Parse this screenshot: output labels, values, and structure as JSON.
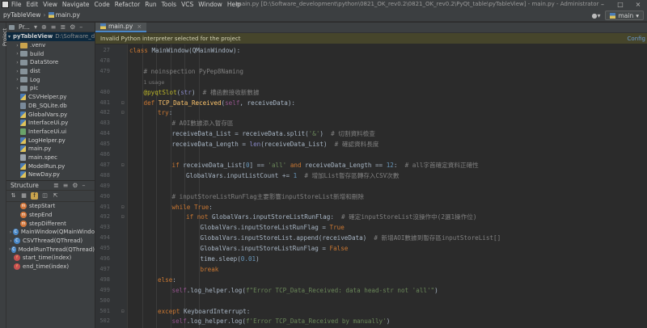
{
  "menubar": {
    "items": [
      "File",
      "Edit",
      "View",
      "Navigate",
      "Code",
      "Refactor",
      "Run",
      "Tools",
      "VCS",
      "Window",
      "Help"
    ],
    "window_title": "main.py [D:\\Software_development\\python\\0821_OK_rev0.2\\0821_OK_rev0.2\\PyQt_table\\pyTableView] - main.py - Administrator"
  },
  "navbar": {
    "project": "pyTableView",
    "file": "main.py",
    "run_config": "main"
  },
  "project_panel": {
    "title": "Pr...",
    "items": [
      {
        "label": "pyTableView",
        "path": "D:\\Software_de",
        "type": "root"
      },
      {
        "label": ".venv",
        "type": "folder-yellow"
      },
      {
        "label": "build",
        "type": "folder"
      },
      {
        "label": "DataStore",
        "type": "folder"
      },
      {
        "label": "dist",
        "type": "folder"
      },
      {
        "label": "Log",
        "type": "folder"
      },
      {
        "label": "pic",
        "type": "folder"
      },
      {
        "label": "CSVHelper.py",
        "type": "py"
      },
      {
        "label": "DB_SQLite.db",
        "type": "db"
      },
      {
        "label": "GlobalVars.py",
        "type": "py"
      },
      {
        "label": "InterfaceUi.py",
        "type": "py"
      },
      {
        "label": "InterfaceUi.ui",
        "type": "ui"
      },
      {
        "label": "LogHelper.py",
        "type": "py"
      },
      {
        "label": "main.py",
        "type": "py"
      },
      {
        "label": "main.spec",
        "type": "spec"
      },
      {
        "label": "ModelRun.py",
        "type": "py"
      },
      {
        "label": "NewDay.py",
        "type": "py"
      }
    ]
  },
  "structure_panel": {
    "title": "Structure",
    "items": [
      {
        "label": "stepStart",
        "kind": "method"
      },
      {
        "label": "stepEnd",
        "kind": "method"
      },
      {
        "label": "stepDifferent",
        "kind": "method"
      },
      {
        "label": "MainWindow(QMainWindo",
        "kind": "cls"
      },
      {
        "label": "CSVThread(QThread)",
        "kind": "cls"
      },
      {
        "label": "ModelRunThread(QThread)",
        "kind": "cls"
      },
      {
        "label": "start_time(index)",
        "kind": "fn"
      },
      {
        "label": "end_time(index)",
        "kind": "fn"
      }
    ]
  },
  "editor": {
    "tab_label": "main.py",
    "banner_text": "Invalid Python interpreter selected for the project",
    "banner_link": "Config",
    "lines": [
      {
        "ln": "27",
        "indent": 0,
        "parts": [
          [
            "kw",
            "class "
          ],
          [
            "txt",
            "MainWindow(QMainWindow):"
          ]
        ]
      },
      {
        "ln": "478",
        "indent": 0,
        "parts": []
      },
      {
        "ln": "479",
        "indent": 1,
        "parts": [
          [
            "cmt",
            "# noinspection PyPep8Naming"
          ]
        ]
      },
      {
        "ln": "",
        "indent": 1,
        "parts": [
          [
            "ann",
            "1 usage"
          ]
        ]
      },
      {
        "ln": "480",
        "indent": 1,
        "parts": [
          [
            "deco",
            "@pyqtSlot"
          ],
          [
            "txt",
            "("
          ],
          [
            "builtin",
            "str"
          ],
          [
            "txt",
            ")  "
          ],
          [
            "cmt",
            "# 槽函數接收新數據"
          ]
        ]
      },
      {
        "ln": "481",
        "indent": 1,
        "parts": [
          [
            "kw",
            "def "
          ],
          [
            "fn",
            "TCP_Data_Received"
          ],
          [
            "txt",
            "("
          ],
          [
            "selfc",
            "self"
          ],
          [
            "txt",
            ", receiveData):"
          ]
        ]
      },
      {
        "ln": "482",
        "indent": 2,
        "parts": [
          [
            "kw",
            "try"
          ],
          [
            "txt",
            ":"
          ]
        ]
      },
      {
        "ln": "483",
        "indent": 3,
        "parts": [
          [
            "cmt",
            "# AOI數據添入暫存區"
          ]
        ]
      },
      {
        "ln": "484",
        "indent": 3,
        "parts": [
          [
            "txt",
            "receiveData_List = receiveData.split("
          ],
          [
            "str",
            "'&'"
          ],
          [
            "txt",
            ")  "
          ],
          [
            "cmt",
            "# 切割資料檢查"
          ]
        ]
      },
      {
        "ln": "485",
        "indent": 3,
        "parts": [
          [
            "txt",
            "receiveData_Length = "
          ],
          [
            "builtin",
            "len"
          ],
          [
            "txt",
            "(receiveData_List)  "
          ],
          [
            "cmt",
            "# 確認資料長度"
          ]
        ]
      },
      {
        "ln": "486",
        "indent": 3,
        "parts": []
      },
      {
        "ln": "487",
        "indent": 3,
        "parts": [
          [
            "kw",
            "if "
          ],
          [
            "txt",
            "receiveData_List["
          ],
          [
            "num",
            "0"
          ],
          [
            "txt",
            "] == "
          ],
          [
            "str",
            "'all'"
          ],
          [
            "kw",
            " and "
          ],
          [
            "txt",
            "receiveData_Length == "
          ],
          [
            "num",
            "12"
          ],
          [
            "txt",
            ":  "
          ],
          [
            "cmt",
            "# all字首確定資料正確性"
          ]
        ]
      },
      {
        "ln": "488",
        "indent": 4,
        "parts": [
          [
            "txt",
            "GlobalVars.inputListCount += "
          ],
          [
            "num",
            "1"
          ],
          [
            "txt",
            "  "
          ],
          [
            "cmt",
            "# 增加List暫存區轉存入CSV次數"
          ]
        ]
      },
      {
        "ln": "489",
        "indent": 3,
        "parts": []
      },
      {
        "ln": "490",
        "indent": 3,
        "parts": [
          [
            "cmt",
            "# inputStoreListRunFlag主要影響inputStoreList新增和刪除"
          ]
        ]
      },
      {
        "ln": "491",
        "indent": 3,
        "parts": [
          [
            "kw",
            "while "
          ],
          [
            "kw",
            "True"
          ],
          [
            "txt",
            ":"
          ]
        ]
      },
      {
        "ln": "492",
        "indent": 4,
        "parts": [
          [
            "kw",
            "if not "
          ],
          [
            "txt",
            "GlobalVars.inputStoreListRunFlag:  "
          ],
          [
            "cmt",
            "# 確定inputStoreList沒操作中(2選1操作位)"
          ]
        ]
      },
      {
        "ln": "493",
        "indent": 5,
        "parts": [
          [
            "txt",
            "GlobalVars.inputStoreListRunFlag = "
          ],
          [
            "kw",
            "True"
          ]
        ]
      },
      {
        "ln": "494",
        "indent": 5,
        "parts": [
          [
            "txt",
            "GlobalVars.inputStoreList.append(receiveData)  "
          ],
          [
            "cmt",
            "# 新增AOI數據到暫存區inputStoreList[]"
          ]
        ]
      },
      {
        "ln": "495",
        "indent": 5,
        "parts": [
          [
            "txt",
            "GlobalVars.inputStoreListRunFlag = "
          ],
          [
            "kw",
            "False"
          ]
        ]
      },
      {
        "ln": "496",
        "indent": 5,
        "parts": [
          [
            "txt",
            "time.sleep("
          ],
          [
            "num",
            "0.01"
          ],
          [
            "txt",
            ")"
          ]
        ]
      },
      {
        "ln": "497",
        "indent": 5,
        "parts": [
          [
            "kw",
            "break"
          ]
        ]
      },
      {
        "ln": "498",
        "indent": 2,
        "parts": [
          [
            "kw",
            "else"
          ],
          [
            "txt",
            ":"
          ]
        ]
      },
      {
        "ln": "499",
        "indent": 3,
        "parts": [
          [
            "selfc",
            "self"
          ],
          [
            "txt",
            ".log_helper.log("
          ],
          [
            "str",
            "f\"Error TCP_Data_Received: data head-str not 'all'\""
          ],
          [
            "txt",
            ")"
          ]
        ]
      },
      {
        "ln": "500",
        "indent": 2,
        "parts": []
      },
      {
        "ln": "501",
        "indent": 2,
        "parts": [
          [
            "kw",
            "except "
          ],
          [
            "txt",
            "KeyboardInterrupt:"
          ]
        ]
      },
      {
        "ln": "502",
        "indent": 3,
        "parts": [
          [
            "selfc",
            "self"
          ],
          [
            "txt",
            ".log_helper.log("
          ],
          [
            "str",
            "f'Error TCP_Data_Received by manually'"
          ],
          [
            "txt",
            ")"
          ]
        ]
      }
    ]
  }
}
